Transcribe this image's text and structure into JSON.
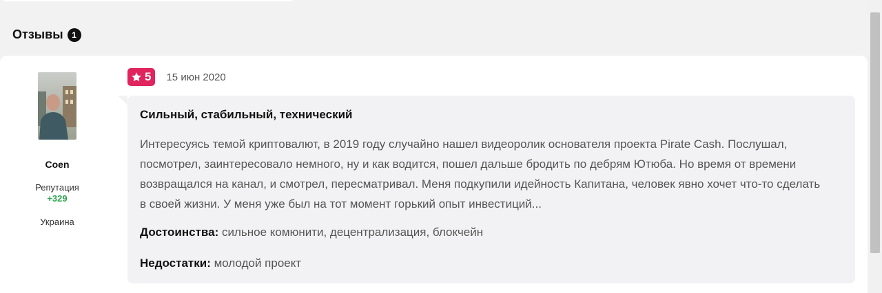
{
  "section": {
    "title": "Отзывы",
    "count": "1"
  },
  "review": {
    "author": {
      "name": "Coen",
      "reputation_label": "Репутация",
      "reputation_value": "+329",
      "country": "Украина"
    },
    "rating": "5",
    "date": "15 июн 2020",
    "title": "Сильный, стабильный, технический",
    "text": "Интересуясь темой криптовалют, в 2019 году случайно нашел видеоролик основателя проекта Pirate Cash. Послушал, посмотрел, заинтересовало немного, ну и как водится, пошел дальше бродить по дебрям Ютюба. Но время от времени возвращался на канал, и смотрел, пересматривал. Меня подкупили идейность Капитана, человек явно хочет что-то сделать в своей жизни. У меня уже был на тот момент горький опыт инвестиций...",
    "pros_label": "Достоинства:",
    "pros": "сильное комюнити, децентрализация, блокчейн",
    "cons_label": "Недостатки:",
    "cons": "молодой проект"
  },
  "colors": {
    "rating_badge": "#e0245e",
    "reputation_positive": "#2ea44f",
    "page_background": "#f2f2f3"
  },
  "icons": {
    "rating": "star-icon"
  }
}
